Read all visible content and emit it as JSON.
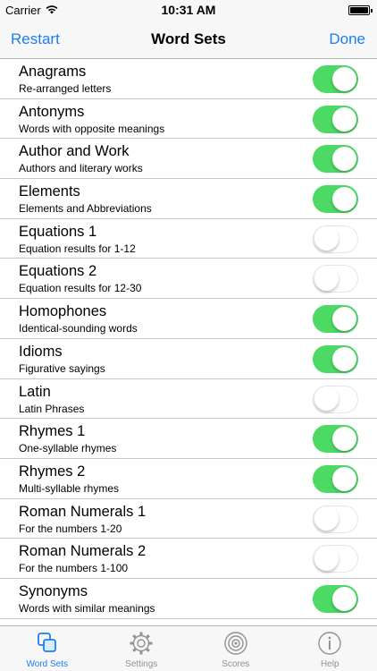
{
  "status": {
    "carrier": "Carrier",
    "time": "10:31 AM"
  },
  "nav": {
    "left": "Restart",
    "title": "Word Sets",
    "right": "Done"
  },
  "rows": [
    {
      "title": "Anagrams",
      "subtitle": "Re-arranged letters",
      "on": true
    },
    {
      "title": "Antonyms",
      "subtitle": "Words with opposite meanings",
      "on": true
    },
    {
      "title": "Author and Work",
      "subtitle": "Authors and literary works",
      "on": true
    },
    {
      "title": "Elements",
      "subtitle": "Elements and Abbreviations",
      "on": true
    },
    {
      "title": "Equations 1",
      "subtitle": "Equation results for 1-12",
      "on": false
    },
    {
      "title": "Equations 2",
      "subtitle": "Equation results for 12-30",
      "on": false
    },
    {
      "title": "Homophones",
      "subtitle": "Identical-sounding words",
      "on": true
    },
    {
      "title": "Idioms",
      "subtitle": "Figurative sayings",
      "on": true
    },
    {
      "title": "Latin",
      "subtitle": "Latin Phrases",
      "on": false
    },
    {
      "title": "Rhymes 1",
      "subtitle": "One-syllable rhymes",
      "on": true
    },
    {
      "title": "Rhymes 2",
      "subtitle": "Multi-syllable rhymes",
      "on": true
    },
    {
      "title": "Roman Numerals 1",
      "subtitle": "For the numbers 1-20",
      "on": false
    },
    {
      "title": "Roman Numerals 2",
      "subtitle": "For the numbers 1-100",
      "on": false
    },
    {
      "title": "Synonyms",
      "subtitle": "Words with similar meanings",
      "on": true
    }
  ],
  "tabs": [
    {
      "label": "Word Sets",
      "icon": "word-sets-icon",
      "active": true
    },
    {
      "label": "Settings",
      "icon": "gear-icon",
      "active": false
    },
    {
      "label": "Scores",
      "icon": "target-icon",
      "active": false
    },
    {
      "label": "Help",
      "icon": "info-icon",
      "active": false
    }
  ],
  "colors": {
    "accent": "#1a7ef5",
    "switch_on": "#4cd964",
    "inactive_tab": "#929292"
  }
}
